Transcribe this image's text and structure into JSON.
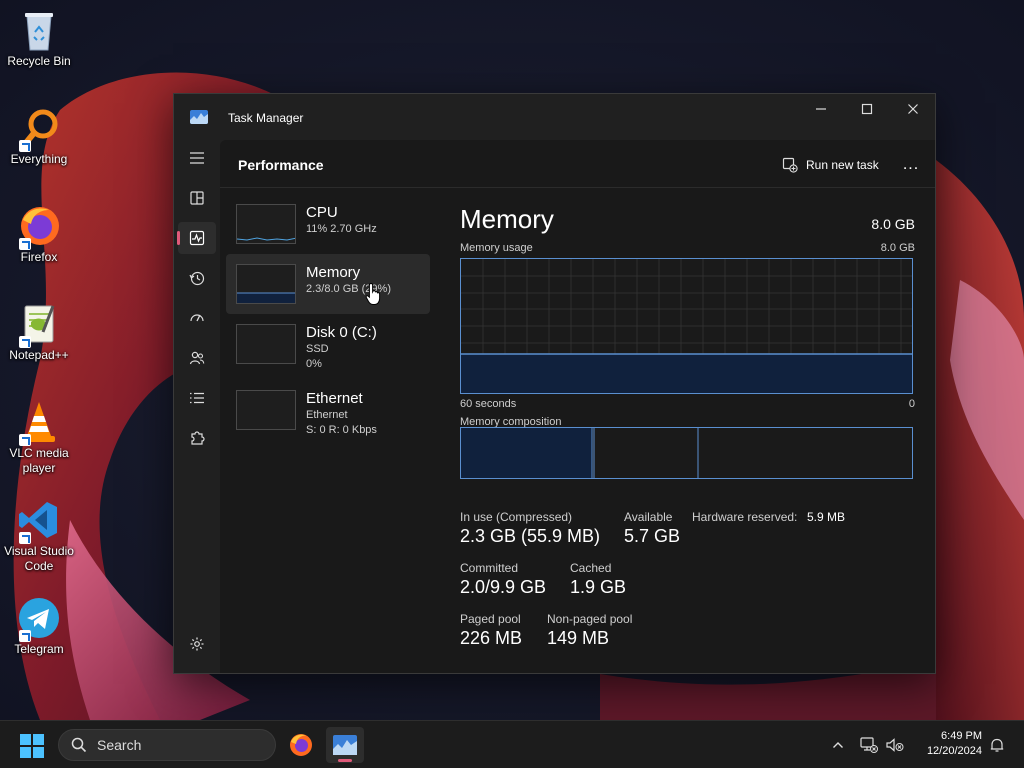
{
  "desktop": {
    "icons": [
      {
        "label": "Recycle Bin",
        "icon": "recycle-bin-icon"
      },
      {
        "label": "Everything",
        "icon": "everything-search-icon"
      },
      {
        "label": "Firefox",
        "icon": "firefox-icon"
      },
      {
        "label": "Notepad++",
        "icon": "notepad-plus-plus-icon"
      },
      {
        "label": "VLC media player",
        "icon": "vlc-icon"
      },
      {
        "label": "Visual Studio Code",
        "icon": "vscode-icon"
      },
      {
        "label": "Telegram",
        "icon": "telegram-icon"
      }
    ]
  },
  "window": {
    "title": "Task Manager",
    "page_title": "Performance",
    "run_new_task": "Run new task",
    "more": "...",
    "nav_items": [
      {
        "name": "menu",
        "icon": "hamburger-icon"
      },
      {
        "name": "processes",
        "icon": "processes-icon"
      },
      {
        "name": "performance",
        "icon": "performance-icon",
        "active": true
      },
      {
        "name": "app-history",
        "icon": "history-icon"
      },
      {
        "name": "startup-apps",
        "icon": "speedometer-icon"
      },
      {
        "name": "users",
        "icon": "users-icon"
      },
      {
        "name": "details",
        "icon": "list-icon"
      },
      {
        "name": "services",
        "icon": "puzzle-icon"
      },
      {
        "name": "settings",
        "icon": "gear-icon"
      }
    ],
    "tiles": [
      {
        "name": "CPU",
        "sub1": "11% 2.70 GHz",
        "sub2": ""
      },
      {
        "name": "Memory",
        "sub1": "2.3/8.0 GB (29%)",
        "sub2": "",
        "selected": true
      },
      {
        "name": "Disk 0 (C:)",
        "sub1": "SSD",
        "sub2": "0%"
      },
      {
        "name": "Ethernet",
        "sub1": "Ethernet",
        "sub2": "S: 0 R: 0 Kbps"
      }
    ],
    "memory": {
      "title": "Memory",
      "total": "8.0 GB",
      "usage_label": "Memory usage",
      "usage_max": "8.0 GB",
      "time_left": "60 seconds",
      "time_right": "0",
      "usage_fraction": 0.29,
      "composition_label": "Memory composition",
      "composition_in_use_fraction": 0.29,
      "composition_modified_fraction": 0.005,
      "composition_standby_fraction": 0.23,
      "stats": {
        "in_use_label": "In use (Compressed)",
        "in_use_value": "2.3 GB (55.9 MB)",
        "available_label": "Available",
        "available_value": "5.7 GB",
        "hw_reserved_label": "Hardware reserved:",
        "hw_reserved_value": "5.9 MB",
        "committed_label": "Committed",
        "committed_value": "2.0/9.9 GB",
        "cached_label": "Cached",
        "cached_value": "1.9 GB",
        "paged_label": "Paged pool",
        "paged_value": "226 MB",
        "nonpaged_label": "Non-paged pool",
        "nonpaged_value": "149 MB"
      }
    }
  },
  "taskbar": {
    "search_label": "Search",
    "time": "6:49 PM",
    "date": "12/20/2024"
  },
  "colors": {
    "accent_pink": "#e05a7a",
    "graph_line": "#5a8fd0",
    "graph_fill": "#10213d"
  }
}
